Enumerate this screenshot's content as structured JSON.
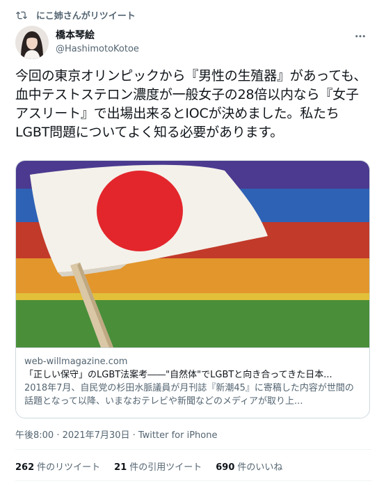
{
  "retweet": {
    "label": "にこ姉さんがリツイート"
  },
  "author": {
    "name": "橋本琴絵",
    "handle": "@HashimotoKotoe"
  },
  "tweet": {
    "text": "今回の東京オリンピックから『男性の生殖器』があっても、血中テストステロン濃度が一般女子の28倍以内なら『女子アスリート』で出場出来るとIOCが決めました。私たちLGBT問題についてよく知る必要があります。"
  },
  "card": {
    "domain": "web-willmagazine.com",
    "title": "「正しい保守」のLGBT法案考――\"自然体\"でLGBTと向き合ってきた日本...",
    "description": "2018年7月、自民党の杉田水脈議員が月刊誌『新潮45』に寄稿した内容が世間の話題となって以降、いまなおテレビや新聞などのメディアが取り上..."
  },
  "meta": {
    "time": "午後8:00 · 2021年7月30日 · Twitter for iPhone"
  },
  "stats": {
    "retweets_count": "262",
    "retweets_label": "件のリツイート",
    "quotes_count": "21",
    "quotes_label": "件の引用ツイート",
    "likes_count": "690",
    "likes_label": "件のいいね"
  },
  "icons": {
    "retweet": "retweet-icon",
    "more": "more-icon"
  },
  "colors": {
    "secondary_text": "#536471",
    "primary_text": "#0f1419",
    "border": "#cfd9de",
    "flag_red": "#e3262c"
  }
}
